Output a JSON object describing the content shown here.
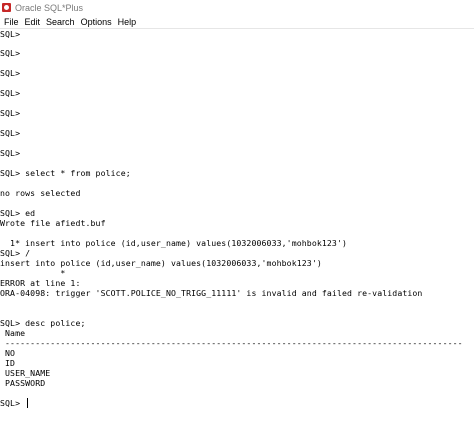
{
  "window": {
    "title": "Oracle SQL*Plus",
    "icon": "oracle-sqlplus-icon"
  },
  "menu": [
    "File",
    "Edit",
    "Search",
    "Options",
    "Help"
  ],
  "console": {
    "lines": [
      "SQL>",
      "SQL>",
      "SQL>",
      "SQL>",
      "SQL>",
      "SQL>",
      "SQL>",
      "SQL> select * from police;",
      "no rows selected",
      "SQL> ed",
      "Wrote file afiedt.buf",
      "  1* insert into police (id,user_name) values(1032006033,'mohbok123')",
      "SQL> /",
      "insert into police (id,user_name) values(1032006033,'mohbok123')",
      "            *",
      "ERROR at line 1:",
      "ORA-04098: trigger 'SCOTT.POLICE_NO_TRIGG_11111' is invalid and failed re-validation",
      "SQL> desc police;",
      " Name",
      " -------------------------------------------------------------------------------------------",
      " NO",
      " ID",
      " USER_NAME",
      " PASSWORD",
      "SQL>"
    ]
  }
}
